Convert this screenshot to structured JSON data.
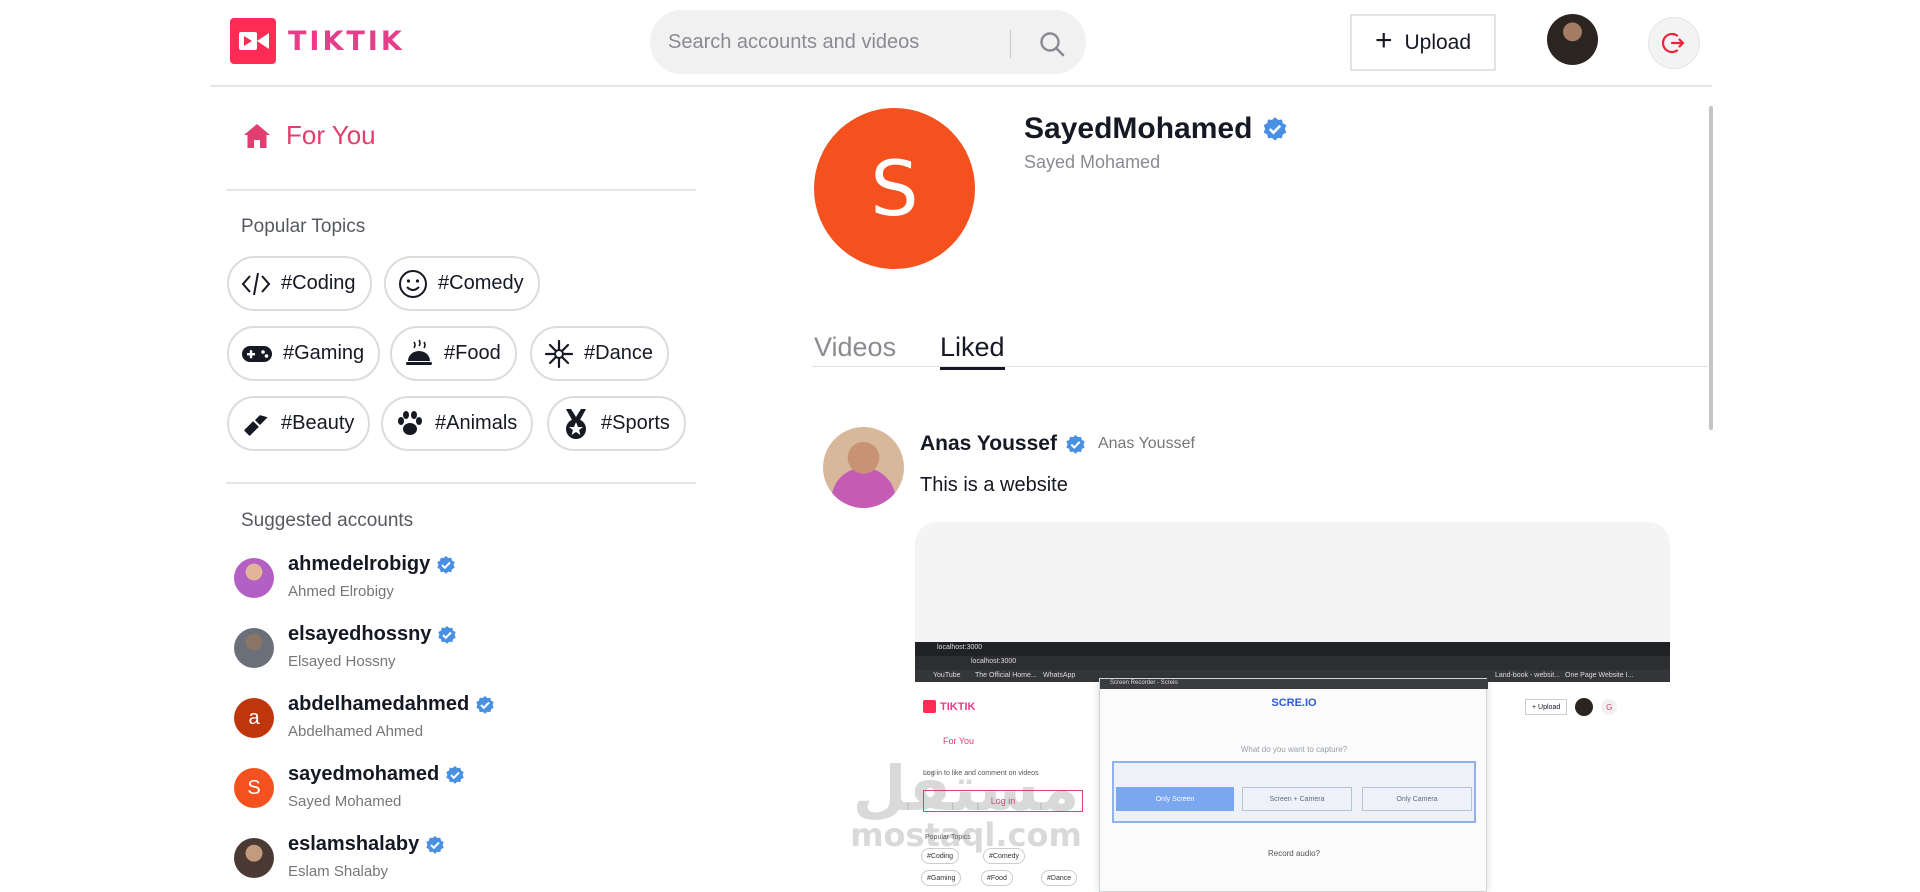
{
  "header": {
    "logo_text": "TIKTIK",
    "search_placeholder": "Search accounts and videos",
    "upload_label": "Upload"
  },
  "sidebar": {
    "for_you_label": "For You",
    "popular_topics_title": "Popular Topics",
    "topics": [
      {
        "label": "#Coding",
        "icon": "code-icon"
      },
      {
        "label": "#Comedy",
        "icon": "smiley-icon"
      },
      {
        "label": "#Gaming",
        "icon": "gamepad-icon"
      },
      {
        "label": "#Food",
        "icon": "food-cloche-icon"
      },
      {
        "label": "#Dance",
        "icon": "dance-icon"
      },
      {
        "label": "#Beauty",
        "icon": "lipstick-icon"
      },
      {
        "label": "#Animals",
        "icon": "paw-icon"
      },
      {
        "label": "#Sports",
        "icon": "medal-icon"
      }
    ],
    "suggested_title": "Suggested accounts",
    "accounts": [
      {
        "handle": "ahmedelrobigy",
        "name": "Ahmed Elrobigy",
        "avatar_letter": "",
        "avatar_color": "#b35fc4"
      },
      {
        "handle": "elsayedhossny",
        "name": "Elsayed Hossny",
        "avatar_letter": "",
        "avatar_color": "#6b6f7a"
      },
      {
        "handle": "abdelhamedahmed",
        "name": "Abdelhamed Ahmed",
        "avatar_letter": "a",
        "avatar_color": "#bf360c"
      },
      {
        "handle": "sayedmohamed",
        "name": "Sayed Mohamed",
        "avatar_letter": "S",
        "avatar_color": "#f4511e"
      },
      {
        "handle": "eslamshalaby",
        "name": "Eslam Shalaby",
        "avatar_letter": "",
        "avatar_color": "#4a3a33"
      }
    ]
  },
  "profile": {
    "avatar_letter": "S",
    "avatar_color": "#f4511e",
    "handle": "SayedMohamed",
    "name": "Sayed Mohamed"
  },
  "tabs": {
    "videos": "Videos",
    "liked": "Liked",
    "active": "Liked"
  },
  "post": {
    "author_handle": "Anas Youssef",
    "author_name": "Anas Youssef",
    "caption": "This is a website",
    "video_preview": {
      "tab_title": "localhost:3000",
      "address": "localhost:3000",
      "bookmarks": [
        "YouTube",
        "The Official Home...",
        "WhatsApp"
      ],
      "bookmarks_right": [
        "Land-book - websit...",
        "One Page Website I..."
      ],
      "logo_text": "TIKTIK",
      "for_you": "For You",
      "login_prompt": "Log in to like and comment on videos",
      "login_button": "Log in",
      "popular_topics": "Popular Topics",
      "topics": [
        "#Coding",
        "#Comedy",
        "#Gaming",
        "#Food",
        "#Dance"
      ],
      "upload_label": "Upload",
      "dialog_window_title": "Screen Recorder - Screlo",
      "dialog_brand": "SCRE.IO",
      "dialog_question": "What do you want to capture?",
      "dialog_options": [
        "Only Screen",
        "Screen + Camera",
        "Only Camera"
      ],
      "dialog_audio": "Record audio?"
    }
  },
  "watermark": {
    "arabic": "مستقل",
    "latin": "mostaql.com"
  },
  "colors": {
    "brand_pink": "#e63e88",
    "for_you_pink": "#e23e6f",
    "verified_blue": "#20d5ec",
    "logo_red": "#fe2c55"
  }
}
